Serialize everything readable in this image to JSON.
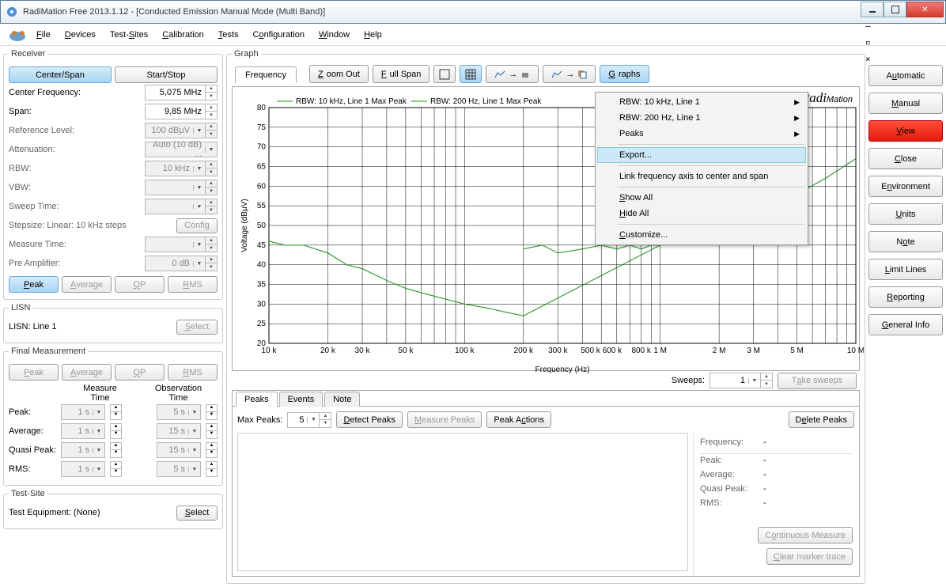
{
  "window": {
    "title": "RadiMation Free 2013.1.12 - [Conducted Emission Manual Mode (Multi Band)]"
  },
  "menu": {
    "file": "File",
    "devices": "Devices",
    "testsites": "Test-Sites",
    "calibration": "Calibration",
    "tests": "Tests",
    "configuration": "Configuration",
    "window": "Window",
    "help": "Help"
  },
  "receiver": {
    "legend": "Receiver",
    "center_span": "Center/Span",
    "start_stop": "Start/Stop",
    "center_freq_lbl": "Center Frequency:",
    "center_freq_val": "5,075 MHz",
    "span_lbl": "Span:",
    "span_val": "9,85 MHz",
    "ref_lbl": "Reference Level:",
    "ref_val": "100 dBµV",
    "att_lbl": "Attenuation:",
    "att_val": "Auto (10 dB) ...",
    "rbw_lbl": "RBW:",
    "rbw_val": "10 kHz",
    "vbw_lbl": "VBW:",
    "vbw_val": "",
    "sweep_lbl": "Sweep Time:",
    "sweep_val": "",
    "step_lbl": "Stepsize: Linear: 10 kHz steps",
    "config": "Config",
    "meas_lbl": "Measure Time:",
    "meas_val": "",
    "preamp_lbl": "Pre Amplifier:",
    "preamp_val": "0 dB",
    "peak": "Peak",
    "average": "Average",
    "qp": "QP",
    "rms": "RMS"
  },
  "lisn": {
    "legend": "LISN",
    "label": "LISN: Line 1",
    "select": "Select"
  },
  "final": {
    "legend": "Final Measurement",
    "peak": "Peak",
    "average": "Average",
    "qp": "QP",
    "rms": "RMS",
    "measure_time": "Measure\nTime",
    "obs_time": "Observation\nTime",
    "rows": {
      "peak": {
        "k": "Peak:",
        "m": "1 s",
        "o": "5 s"
      },
      "avg": {
        "k": "Average:",
        "m": "1 s",
        "o": "15 s"
      },
      "qp": {
        "k": "Quasi Peak:",
        "m": "1 s",
        "o": "15 s"
      },
      "rms": {
        "k": "RMS:",
        "m": "1 s",
        "o": "5 s"
      }
    }
  },
  "testsite": {
    "legend": "Test-Site",
    "label": "Test Equipment: (None)",
    "select": "Select"
  },
  "graph": {
    "legend": "Graph",
    "tab_frequency": "Frequency",
    "zoom_out": "Zoom Out",
    "full_span": "Full Span",
    "graphs": "Graphs",
    "brand": "RadiMation",
    "legend1": "RBW: 10 kHz, Line 1 Max Peak",
    "legend2": "RBW: 200 Hz, Line 1 Max Peak",
    "ylabel": "Voltage (dBµV)",
    "xlabel": "Frequency (Hz)"
  },
  "ctx": {
    "rbw10": "RBW: 10 kHz, Line 1",
    "rbw200": "RBW: 200 Hz, Line 1",
    "peaks": "Peaks",
    "export": "Export...",
    "link": "Link frequency axis to center and span",
    "showall": "Show All",
    "hideall": "Hide All",
    "customize": "Customize..."
  },
  "sweeps": {
    "label": "Sweeps:",
    "val": "1",
    "take": "Take sweeps"
  },
  "btabs": {
    "peaks": "Peaks",
    "events": "Events",
    "note": "Note"
  },
  "peaks": {
    "max_lbl": "Max Peaks:",
    "max_val": "5",
    "detect": "Detect Peaks",
    "measure": "Measure Peaks",
    "actions": "Peak Actions",
    "delete": "Delete Peaks",
    "info": {
      "freq": "Frequency:",
      "peak": "Peak:",
      "avg": "Average:",
      "qp": "Quasi Peak:",
      "rms": "RMS:",
      "dash": "-"
    },
    "cont": "Continuous Measure",
    "clear": "Clear marker trace"
  },
  "rbuttons": {
    "automatic": "Automatic",
    "manual": "Manual",
    "view": "View",
    "close": "Close",
    "environment": "Environment",
    "units": "Units",
    "note": "Note",
    "limit": "Limit Lines",
    "reporting": "Reporting",
    "general": "General Info"
  },
  "chart_data": {
    "type": "line",
    "xscale": "log",
    "xlim": [
      10000,
      10000000
    ],
    "ylim": [
      20,
      80
    ],
    "xticks": [
      10000,
      20000,
      30000,
      50000,
      100000,
      200000,
      300000,
      500000,
      600000,
      800000,
      1000000,
      2000000,
      3000000,
      5000000,
      10000000
    ],
    "xticklabels": [
      "10 k",
      "20 k",
      "30 k",
      "50 k",
      "100 k",
      "200 k",
      "300 k",
      "500 k 600 k",
      "",
      "800 k",
      "1 M",
      "2 M",
      "3 M",
      "5 M",
      "10 M"
    ],
    "yticks": [
      20,
      25,
      30,
      35,
      40,
      45,
      50,
      55,
      60,
      65,
      70,
      75,
      80
    ],
    "xlabel": "Frequency (Hz)",
    "ylabel": "Voltage (dBµV)",
    "series": [
      {
        "name": "RBW: 10 kHz, Line 1 Max Peak",
        "color": "#1a8a1a",
        "x": [
          10000,
          12000,
          15000,
          20000,
          25000,
          30000,
          40000,
          50000,
          70000,
          100000,
          130000,
          160000,
          200000,
          1000000,
          2000000,
          3000000,
          5000000,
          7000000,
          10000000
        ],
        "y": [
          46,
          45,
          45,
          43,
          40,
          39,
          36,
          34,
          32,
          30,
          29,
          28,
          27,
          45,
          48,
          54,
          58,
          62,
          67
        ]
      },
      {
        "name": "RBW: 200 Hz, Line 1 Max Peak",
        "color": "#1a8a1a",
        "x": [
          200000,
          250000,
          300000,
          400000,
          500000,
          600000,
          700000,
          800000,
          900000,
          1000000
        ],
        "y": [
          44,
          45,
          43,
          44,
          45,
          44,
          45,
          44,
          45,
          45
        ]
      }
    ]
  }
}
